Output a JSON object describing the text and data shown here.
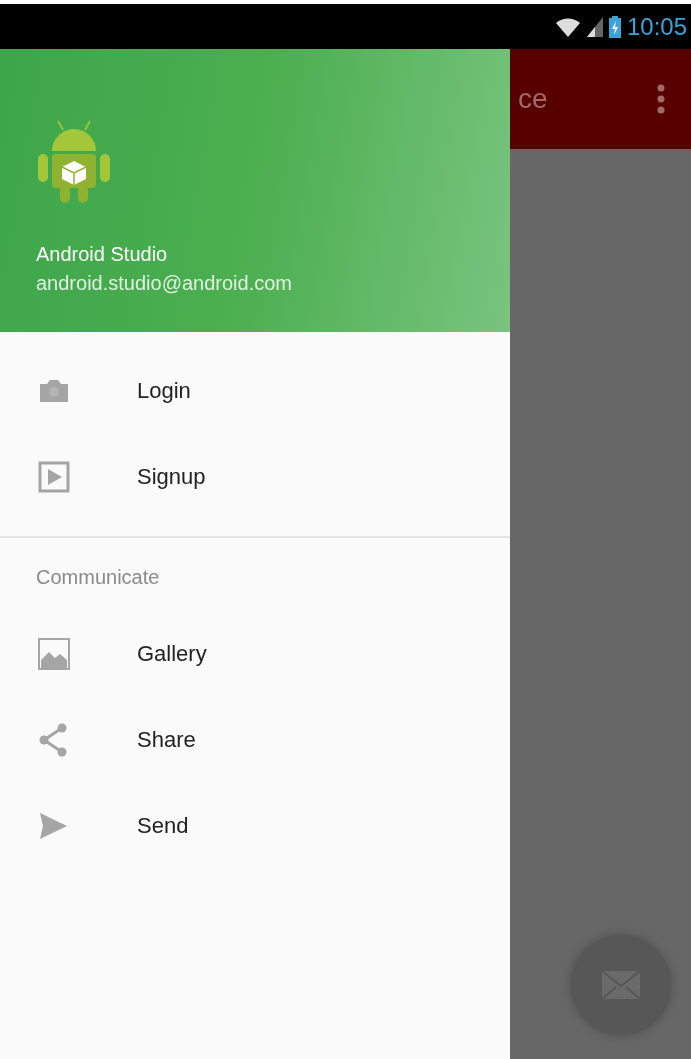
{
  "status_bar": {
    "time": "10:05"
  },
  "app_bar": {
    "title": "ce"
  },
  "drawer": {
    "header": {
      "name": "Android Studio",
      "email": "android.studio@android.com"
    },
    "groups": [
      {
        "items": [
          {
            "label": "Login"
          },
          {
            "label": "Signup"
          }
        ]
      },
      {
        "title": "Communicate",
        "items": [
          {
            "label": "Gallery"
          },
          {
            "label": "Share"
          },
          {
            "label": "Send"
          }
        ]
      }
    ]
  }
}
